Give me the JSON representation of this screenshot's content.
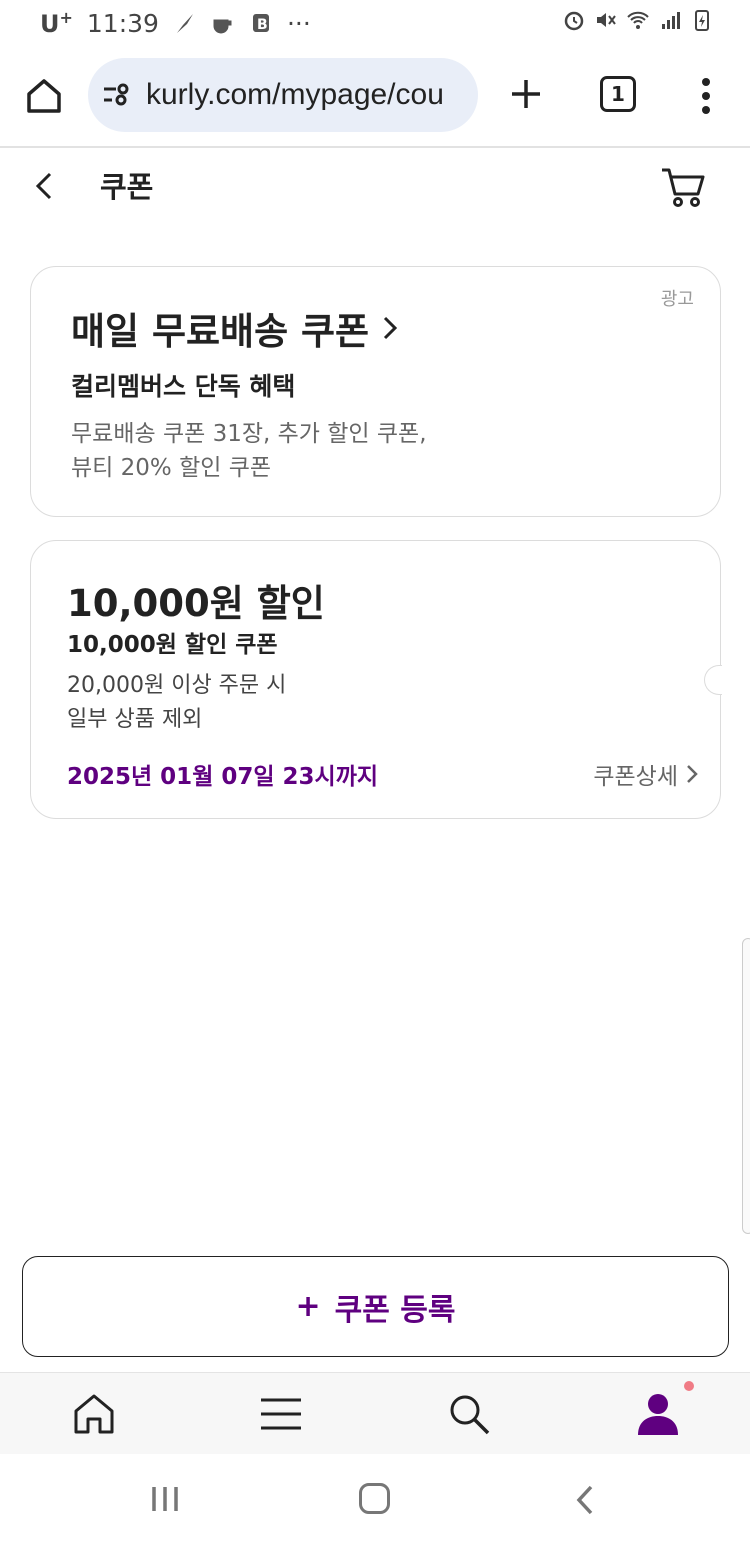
{
  "status_bar": {
    "carrier": "U",
    "carrier_sup": "+",
    "time": "11:39",
    "dots": "···",
    "notification_icons": [
      "feather-icon",
      "coffee-icon",
      "b-app-icon"
    ],
    "status_icons": [
      "alarm-icon",
      "mute-icon",
      "wifi-icon",
      "signal-icon",
      "battery-icon"
    ]
  },
  "browser": {
    "url": "kurly.com/mypage/cou",
    "tab_count": "1"
  },
  "header": {
    "title": "쿠폰"
  },
  "ad_card": {
    "label": "광고",
    "title": "매일 무료배송 쿠폰",
    "subtitle": "컬리멤버스 단독 혜택",
    "desc_line1": "무료배송 쿠폰 31장, 추가 할인 쿠폰,",
    "desc_line2": "뷰티 20% 할인 쿠폰"
  },
  "coupon": {
    "amount": "10,000원 할인",
    "name": "10,000원 할인 쿠폰",
    "condition1": "20,000원 이상 주문 시",
    "condition2": "일부 상품 제외",
    "expiry": "2025년 01월 07일 23시까지",
    "detail_label": "쿠폰상세"
  },
  "register_button": {
    "plus": "+",
    "label": "쿠폰 등록"
  },
  "colors": {
    "accent": "#5f0080",
    "notification_dot": "#f07b85"
  }
}
